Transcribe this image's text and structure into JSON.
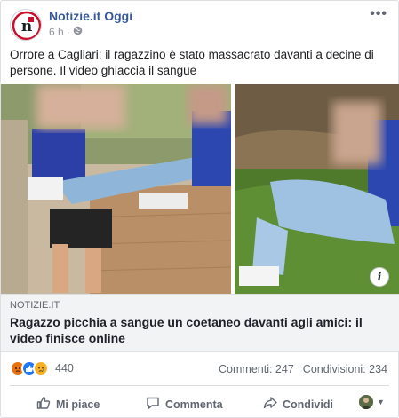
{
  "header": {
    "page_name": "Notizie.it Oggi",
    "time": "6 h",
    "dot": "·",
    "more": "•••"
  },
  "post": {
    "caption": "Orrore a Cagliari: il ragazzino è stato massacrato davanti a decine di persone. Il video ghiaccia il sangue"
  },
  "link": {
    "domain": "NOTIZIE.IT",
    "title": "Ragazzo picchia a sangue un coetaneo davanti agli amici: il video finisce online",
    "info": "i"
  },
  "stats": {
    "reactions_count": "440",
    "comments": "Commenti: 247",
    "shares": "Condivisioni: 234"
  },
  "actions": {
    "like": "Mi piace",
    "comment": "Commenta",
    "share": "Condividi"
  },
  "colors": {
    "page_name": "#385898",
    "like_reaction": "#2078f4",
    "angry_reaction": "#e9710f",
    "sad_reaction": "#f7b125"
  },
  "icons": [
    "globe-icon",
    "more-dots-icon",
    "info-icon",
    "like-thumb-icon",
    "comment-bubble-icon",
    "share-arrow-icon",
    "caret-down-icon"
  ]
}
